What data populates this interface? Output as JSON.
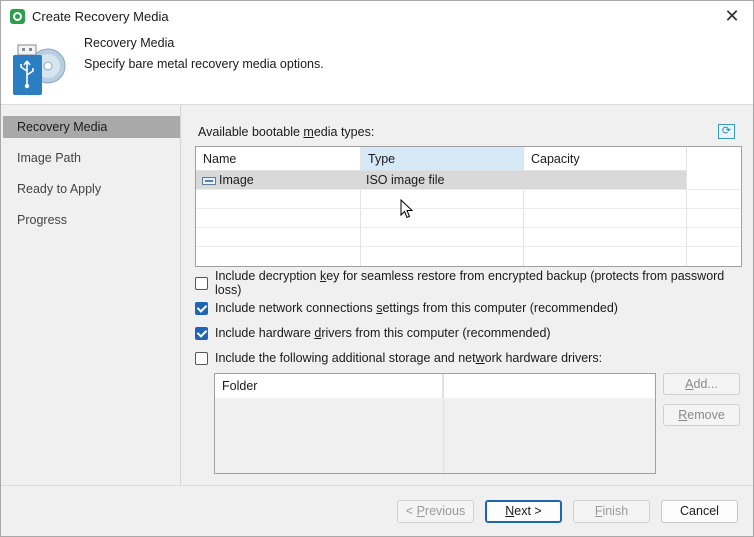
{
  "window": {
    "title": "Create Recovery Media",
    "close_label": "✕"
  },
  "header": {
    "title": "Recovery Media",
    "subtitle": "Specify bare metal recovery media options."
  },
  "nav": {
    "items": [
      "Recovery Media",
      "Image Path",
      "Ready to Apply",
      "Progress"
    ],
    "active_index": 0
  },
  "media": {
    "label_pre": "Available bootable ",
    "label_u": "m",
    "label_post": "edia types:",
    "columns": [
      "Name",
      "Type",
      "Capacity"
    ],
    "rows": [
      {
        "name": "Image",
        "type": "ISO image file",
        "capacity": ""
      }
    ]
  },
  "options": [
    {
      "pre": "Include decryption ",
      "u": "k",
      "post": "ey for seamless restore from encrypted backup (protects from password loss)",
      "checked": false
    },
    {
      "pre": "Include network connections ",
      "u": "s",
      "post": "ettings from this computer (recommended)",
      "checked": true
    },
    {
      "pre": "Include hardware ",
      "u": "d",
      "post": "rivers from this computer (recommended)",
      "checked": true
    },
    {
      "pre": "Include the following additional storage and net",
      "u": "w",
      "post": "ork hardware drivers:",
      "checked": false
    }
  ],
  "drivers": {
    "columns": [
      "Folder"
    ],
    "add_label": "Add...",
    "add_u": "A",
    "remove_label": "emove",
    "remove_u": "R"
  },
  "footer": {
    "previous": {
      "pre": "< ",
      "u": "P",
      "post": "revious"
    },
    "next": {
      "u": "N",
      "post": "ext >"
    },
    "finish": {
      "u": "F",
      "post": "inish"
    },
    "cancel": "Cancel"
  },
  "colors": {
    "accent": "#1f65b5",
    "nav_active": "#a9a9a9",
    "header_hover": "#d7e8f7"
  }
}
